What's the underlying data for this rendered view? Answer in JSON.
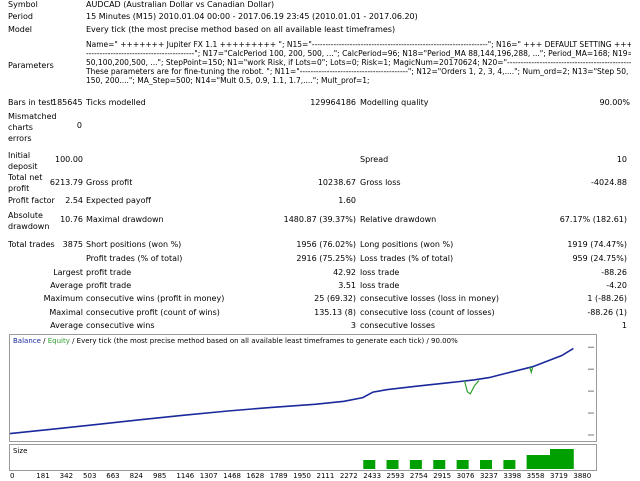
{
  "header": {
    "symbol_label": "Symbol",
    "symbol_value": "AUDCAD (Australian Dollar vs Canadian Dollar)",
    "period_label": "Period",
    "period_value": "15 Minutes (M15) 2010.01.04 00:00 - 2017.06.19 23:45 (2010.01.01 - 2017.06.20)",
    "model_label": "Model",
    "model_value": "Every tick (the most precise method based on all available least timeframes)",
    "params_label": "Parameters",
    "params_lines": [
      "Name=\" +++++++ Jupiter FX 1.1 +++++++++ \"; N15=\"-----------------------------------------------------------------\"; N16=\" +++ DEFAULT SETTING +++ \"; N22=\"-",
      "----------------------------------------\"; N17=\"CalcPeriod 100, 200, 500, ...\"; CalcPeriod=96; N18=\"Period_MA 88,144,196,288, ...\"; Period_MA=168; N19=\"StepPoint",
      "50,100,200,500, ...\"; StepPoint=150; N1=\"work Risk, if Lots=0\"; Lots=0; Risk=1; MagicNum=20170624; N20=\"-----------------------------------------------------------\"; N3=\"",
      "These parameters are for fine-tuning the robot. \"; N11=\"----------------------------------------\"; N12=\"Orders 1, 2, 3, 4,....\"; Num_ord=2; N13=\"Step 50, 100,",
      "150, 200....\"; MA_Step=500; N14=\"Mult 0.5, 0.9, 1.1, 1.7,....\"; Mult_prof=1;"
    ]
  },
  "stats": {
    "bars_label": "Bars in test",
    "bars_value": "185645",
    "ticks_label": "Ticks modelled",
    "ticks_value": "129964186",
    "quality_label": "Modelling quality",
    "quality_value": "90.00%",
    "mismatch_label": "Mismatched charts errors",
    "mismatch_lines": [
      "Mismatched",
      "charts",
      "errors"
    ],
    "mismatch_value": "0",
    "deposit_lines": [
      "Initial",
      "deposit"
    ],
    "deposit_value": "100.00",
    "spread_label": "Spread",
    "spread_value": "10",
    "netprofit_lines": [
      "Total net",
      "profit"
    ],
    "netprofit_value": "6213.79",
    "grossprofit_label": "Gross profit",
    "grossprofit_value": "10238.67",
    "grossloss_label": "Gross loss",
    "grossloss_value": "-4024.88",
    "pf_label": "Profit factor",
    "pf_value": "2.54",
    "payoff_label": "Expected payoff",
    "payoff_value": "1.60",
    "absdd_lines": [
      "Absolute",
      "drawdown"
    ],
    "absdd_value": "10.76",
    "maxdd_label": "Maximal drawdown",
    "maxdd_value": "1480.87 (39.37%)",
    "reldd_label": "Relative drawdown",
    "reldd_value": "67.17% (182.61)",
    "trades_label": "Total trades",
    "trades_value": "3875",
    "short_label": "Short positions (won %)",
    "short_value": "1956 (76.02%)",
    "long_label": "Long positions (won %)",
    "long_value": "1919 (74.47%)",
    "pt_label": "Profit trades (% of total)",
    "pt_value": "2916 (75.25%)",
    "lt_label": "Loss trades (% of total)",
    "lt_value": "959 (24.75%)",
    "largest_label": "Largest",
    "lg_profit_label": "profit trade",
    "lg_profit_value": "42.92",
    "lg_loss_label": "loss trade",
    "lg_loss_value": "-88.26",
    "average_label": "Average",
    "av_profit_label": "profit trade",
    "av_profit_value": "3.51",
    "av_loss_label": "loss trade",
    "av_loss_value": "-4.20",
    "maxcons_label": "Maximum",
    "mc_wins_label": "consecutive wins (profit in money)",
    "mc_wins_value": "25 (69.32)",
    "mc_losses_label": "consecutive losses (loss in money)",
    "mc_losses_value": "1 (-88.26)",
    "maximal_label": "Maximal",
    "mx_profit_label": "consecutive profit (count of wins)",
    "mx_profit_value": "135.13 (8)",
    "mx_loss_label": "consecutive loss (count of losses)",
    "mx_loss_value": "-88.26 (1)",
    "avgcons_label": "Average",
    "ac_wins_label": "consecutive wins",
    "ac_wins_value": "3",
    "ac_losses_label": "consecutive losses",
    "ac_losses_value": "1"
  },
  "chart_data": {
    "type": "line",
    "legend_balance": "Balance",
    "legend_sep": " / ",
    "legend_equity": "Equity",
    "legend_rest": " / Every tick (the most precise method based on all available least timeframes to generate each tick) / 90.00%",
    "y_ticks": [
      "6296",
      "4722",
      "3148",
      "1574",
      "0"
    ],
    "y_tick_values": [
      6296,
      4722,
      3148,
      1574,
      0
    ],
    "ylim": [
      0,
      6600
    ],
    "xlim": [
      0,
      3960
    ],
    "x_ticks": [
      "0",
      "181",
      "342",
      "503",
      "663",
      "824",
      "985",
      "1146",
      "1307",
      "1468",
      "1628",
      "1789",
      "1950",
      "2111",
      "2272",
      "2433",
      "2593",
      "2754",
      "2915",
      "3076",
      "3237",
      "3398",
      "3558",
      "3719",
      "3880"
    ],
    "balance": {
      "x": [
        0,
        300,
        600,
        900,
        1200,
        1500,
        1800,
        2100,
        2300,
        2430,
        2500,
        2600,
        2800,
        3000,
        3100,
        3200,
        3300,
        3400,
        3600,
        3800,
        3880
      ],
      "y": [
        100,
        420,
        760,
        1100,
        1420,
        1720,
        1980,
        2200,
        2420,
        2680,
        3080,
        3260,
        3500,
        3720,
        3840,
        3960,
        4120,
        4380,
        4900,
        5700,
        6213
      ]
    },
    "equity_dips": [
      {
        "x": [
          3130,
          3150,
          3170,
          3200,
          3230
        ],
        "y": [
          3880,
          3100,
          2950,
          3550,
          3900
        ]
      },
      {
        "x": [
          3580,
          3590,
          3600
        ],
        "y": [
          4850,
          4500,
          4880
        ]
      }
    ],
    "colors": {
      "balance": "#1a2a9c",
      "equity": "#2e9e2e",
      "legend_blue": "#1a2a9c",
      "size_bar": "#00a000"
    },
    "size_label": "Size",
    "size": {
      "x": [
        2433,
        2593,
        2754,
        2915,
        3076,
        3237,
        3398,
        3558,
        3639,
        3719,
        3800
      ],
      "h": [
        0.45,
        0.45,
        0.45,
        0.45,
        0.45,
        0.45,
        0.45,
        0.7,
        0.7,
        1.0,
        1.0
      ]
    }
  }
}
